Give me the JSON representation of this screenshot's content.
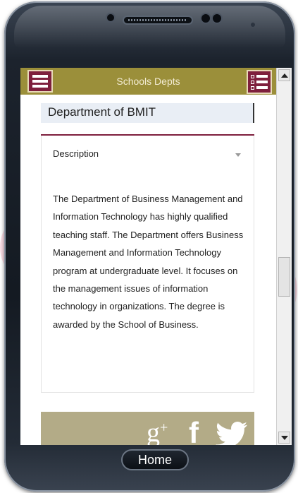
{
  "app": {
    "title": "Schools Depts",
    "menu_icon": "hamburger-icon",
    "list_icon": "list-icon",
    "accent_color": "#7e1f3d",
    "bar_color": "#9b8f3a"
  },
  "content": {
    "department_title": "Department of BMIT",
    "description_label": "Description",
    "description_text": "The Department of Business Management and Information Technology has highly qualified teaching staff. The Department offers Business Management and Information Technology program at undergraduate level. It focuses on the management issues of information technology in organizations. The degree is awarded by the School of Business."
  },
  "social": {
    "googleplus_label": "g",
    "googleplus_sup": "+",
    "facebook_label": "f",
    "twitter_icon": "twitter-icon"
  },
  "device": {
    "home_label": "Home"
  }
}
